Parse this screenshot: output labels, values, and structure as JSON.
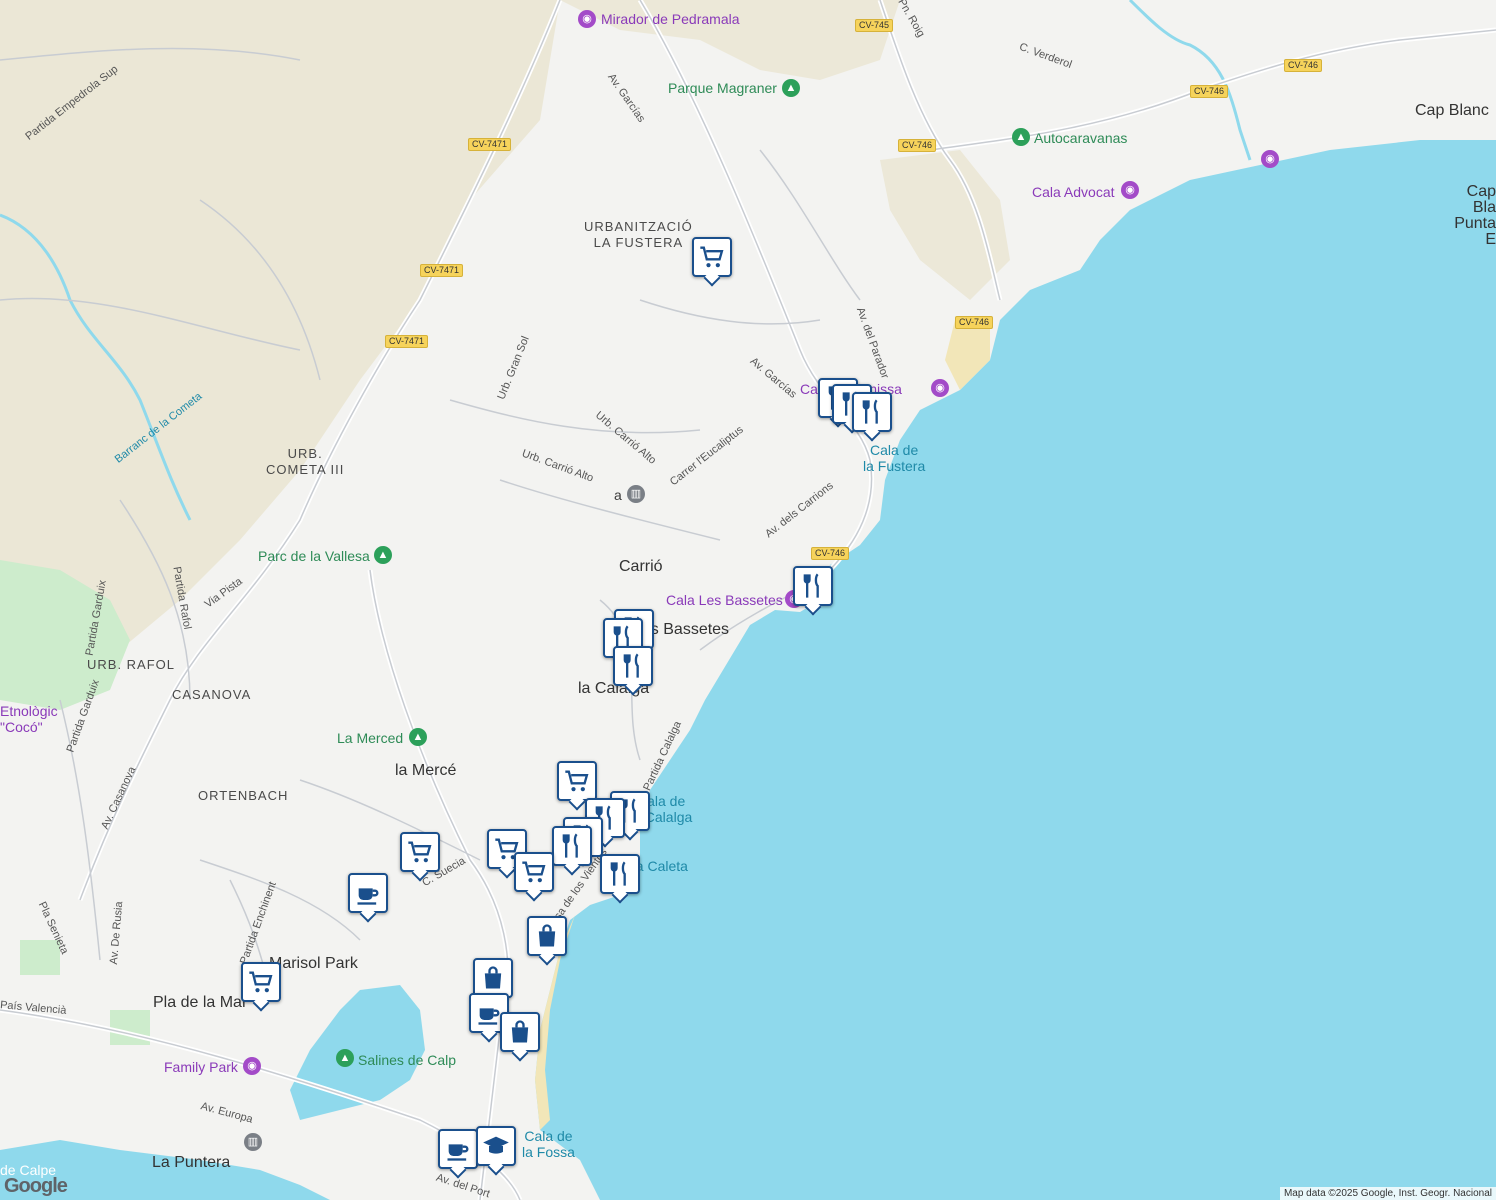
{
  "map": {
    "labels": {
      "mirador": "Mirador de Pedramala",
      "parque_magraner": "Parque Magraner",
      "autocaravanas": "Autocaravanas",
      "cala_advocat": "Cala Advocat",
      "cap_blanc": "Cap Blanc",
      "cap_blanc_punta": "Cap Bla\nPunta E",
      "urb_la_fustera": "URBANITZACIÓ\nLA FUSTERA",
      "urb_cometa": "URB.\nCOMETA III",
      "cala_benissa": "Cala de Benissa",
      "cala_fustera": "Cala de\nla Fustera",
      "parc_vallesa": "Parc de la Vallesa",
      "carrio": "Carrió",
      "cala_bassetes": "Cala Les Bassetes",
      "les_bassetes": "Les Bassetes",
      "la_calalga": "la Calalga",
      "urb_rafol": "URB. RAFOL",
      "casanova": "CASANOVA",
      "etnologic": "Etnològic\n\"Cocó\"",
      "la_merced_park": "La Merced",
      "la_merce": "la Mercé",
      "ortenbach": "ORTENBACH",
      "cala_calalga": "Cala de\nla Calalga",
      "la_caleta": "La Caleta",
      "marisol_park": "Marisol Park",
      "pla_de_la_mar": "Pla de la Mar",
      "family_park": "Family Park",
      "salines": "Salines de Calp",
      "la_puntera": "La Puntera",
      "cala_fossa": "Cala de\nla Fossa",
      "calpe": "de Calpe",
      "a_museum": "a"
    },
    "roads": {
      "cv745": "CV-745",
      "cv746a": "CV-746",
      "cv746b": "CV-746",
      "cv746c": "CV-746",
      "cv746d": "CV-746",
      "cv7471a": "CV-7471",
      "cv7471b": "CV-7471",
      "cv7471c": "CV-7471",
      "cv746e": "CV-746",
      "av_garcias_n": "Av. Garcías",
      "av_garcias_s": "Av. Garcías",
      "c_verderol": "C. Verderol",
      "partida_empedrola": "Partida Empedrola Sup",
      "barranc_cometa": "Barranc de la Cometa",
      "urb_gran_sol": "Urb. Gran Sol",
      "urb_carrio_alto1": "Urb. Carrió Alto",
      "urb_carrio_alto2": "Urb. Carrió Alto",
      "carrer_eucaliptus": "Carrer l'Eucaliptus",
      "av_carrions": "Av. dels Carrions",
      "av_parador": "Av. del Parador",
      "via_pista": "Via Pista",
      "partida_rafol": "Partida Rafol",
      "partida_garduix1": "Partida Garduix",
      "partida_garduix2": "Partida Garduix",
      "av_casanova": "Av. Casanova",
      "partida_calalga": "Partida Calalga",
      "c_suecia": "C. Suecia",
      "rosa_vientos": "Rosa de los Vientos",
      "partida_enchinent": "Partida Enchinent",
      "pla_senieta": "Pla Senieta",
      "av_rusia": "Av. De Rusia",
      "pais_valencia": "País Valencià",
      "av_europa": "Av. Europa",
      "av_port": "Av. del Port",
      "pn_roig": "Pn. Roig"
    },
    "attribution": "Map data ©2025 Google, Inst. Geogr. Nacional",
    "logo": "Google",
    "colors": {
      "sea": "#8fd9ec",
      "land": "#f3f3f1",
      "park": "#c8ebc9",
      "sand": "#ede6cf",
      "pin_border": "#1a4f8c"
    }
  }
}
